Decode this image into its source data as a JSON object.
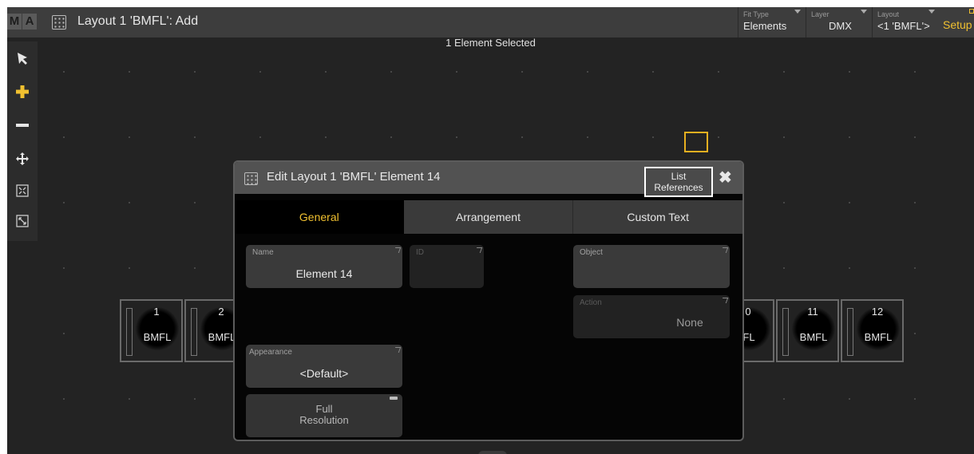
{
  "titlebar": {
    "logo_m": "M",
    "logo_a": "A",
    "title": "Layout 1 'BMFL': Add",
    "fit_type": {
      "label": "Fit Type",
      "value": "Elements"
    },
    "layer": {
      "label": "Layer",
      "value": "DMX"
    },
    "layout": {
      "label": "Layout",
      "value": "<1 'BMFL'>"
    },
    "setup": "Setup"
  },
  "canvas": {
    "selection_text": "1 Element Selected",
    "fixtures_left": [
      {
        "number": "1",
        "name": "BMFL"
      },
      {
        "number": "2",
        "name": "BMFL"
      }
    ],
    "fixtures_right": [
      {
        "number": "0",
        "name": "FL"
      },
      {
        "number": "11",
        "name": "BMFL"
      },
      {
        "number": "12",
        "name": "BMFL"
      }
    ]
  },
  "toolbar": {
    "tools": [
      "select-arrow-icon",
      "add-plus-icon",
      "remove-minus-icon",
      "move-icon",
      "fit-icon",
      "resize-icon"
    ]
  },
  "dialog": {
    "title": "Edit Layout 1 'BMFL' Element 14",
    "list_references_label": "List\nReferences",
    "tabs": [
      "General",
      "Arrangement",
      "Custom Text"
    ],
    "active_tab": "General",
    "fields": {
      "name": {
        "label": "Name",
        "value": "Element 14"
      },
      "id": {
        "label": "ID",
        "value": ""
      },
      "object": {
        "label": "Object",
        "value": ""
      },
      "action": {
        "label": "Action",
        "value": "None"
      },
      "appearance": {
        "label": "Appearance",
        "value": "<Default>"
      },
      "full_resolution": {
        "label": "Full\nResolution"
      }
    }
  },
  "colors": {
    "accent": "#f0c030",
    "background": "#232323",
    "panel": "#3a3a3a"
  }
}
